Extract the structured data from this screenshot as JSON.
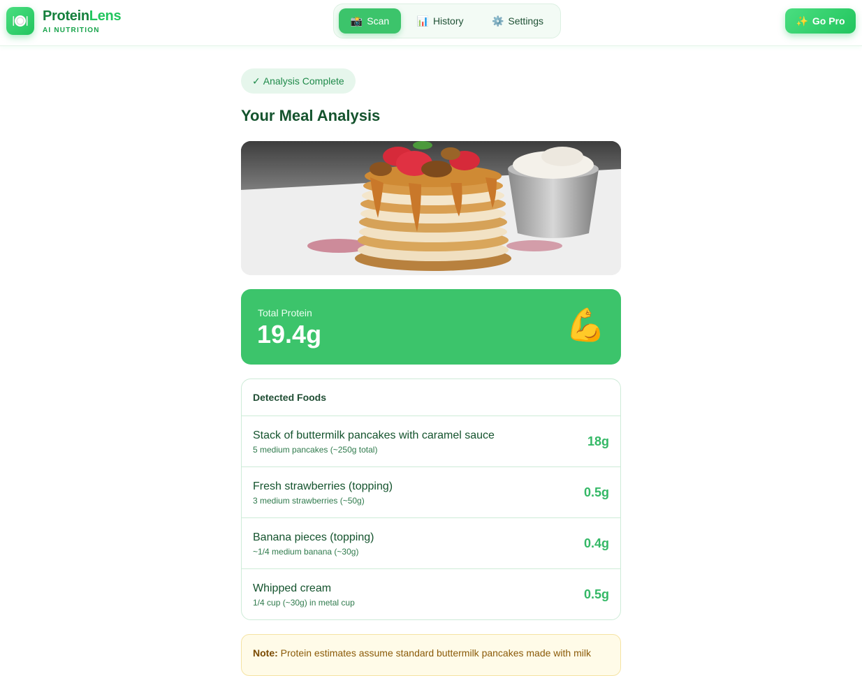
{
  "app": {
    "brand_part1": "Protein",
    "brand_part2": "Lens",
    "tagline": "AI NUTRITION",
    "logo_icon": "plate-icon"
  },
  "nav": {
    "items": [
      {
        "icon": "📸",
        "label": "Scan",
        "active": true
      },
      {
        "icon": "📊",
        "label": "History",
        "active": false
      },
      {
        "icon": "⚙️",
        "label": "Settings",
        "active": false
      }
    ],
    "go_pro_icon": "✨",
    "go_pro_label": "Go Pro"
  },
  "status_badge": {
    "check": "✓",
    "label": "Analysis Complete"
  },
  "page_title": "Your Meal Analysis",
  "total_protein": {
    "label": "Total Protein",
    "value": "19.4g",
    "icon": "💪"
  },
  "foods": {
    "header": "Detected Foods",
    "items": [
      {
        "name": "Stack of buttermilk pancakes with caramel sauce",
        "qty": "5 medium pancakes (~250g total)",
        "protein": "18g"
      },
      {
        "name": "Fresh strawberries (topping)",
        "qty": "3 medium strawberries (~50g)",
        "protein": "0.5g"
      },
      {
        "name": "Banana pieces (topping)",
        "qty": "~1/4 medium banana (~30g)",
        "protein": "0.4g"
      },
      {
        "name": "Whipped cream",
        "qty": "1/4 cup (~30g) in metal cup",
        "protein": "0.5g"
      }
    ]
  },
  "note": {
    "label": "Note:",
    "text": "Protein estimates assume standard buttermilk pancakes made with milk"
  },
  "colors": {
    "accent": "#3cc46b",
    "dark_green": "#14532d",
    "badge_bg": "#e6f6ec",
    "note_bg": "#fffbe8"
  }
}
